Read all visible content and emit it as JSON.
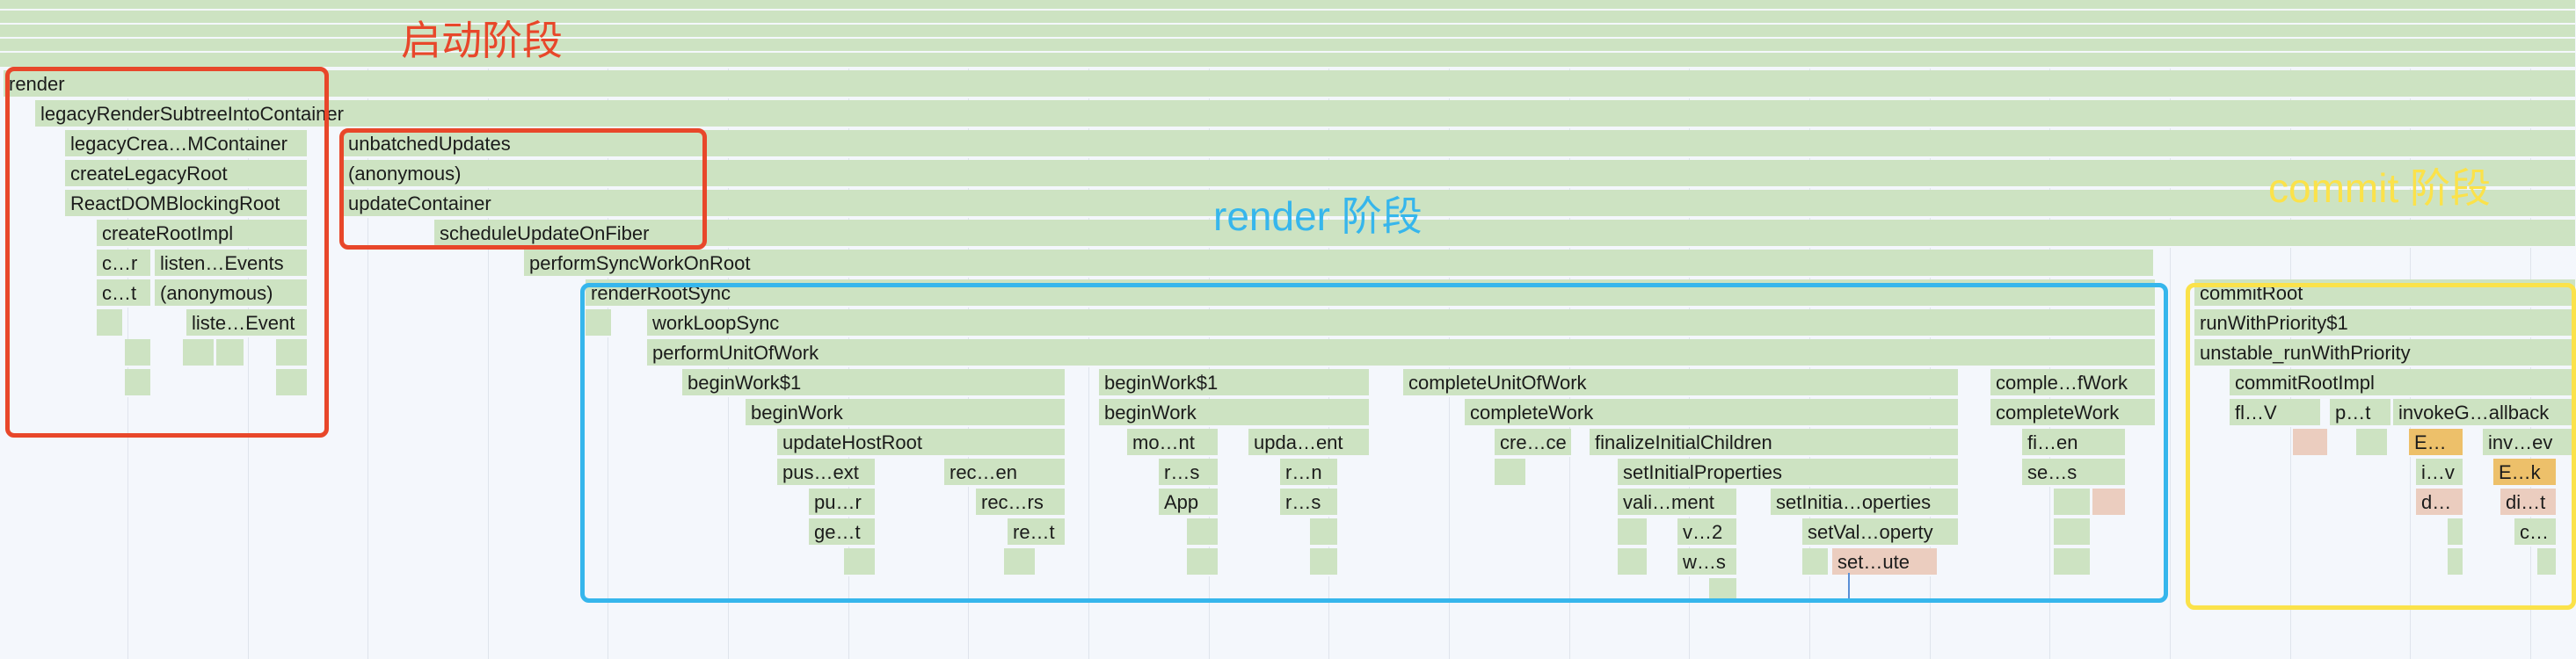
{
  "annotations": {
    "startup_label": "启动阶段",
    "render_label": "render 阶段",
    "commit_label": "commit 阶段"
  },
  "colors": {
    "frame": "#cde3c2",
    "frame_hot": "#edc06a",
    "frame_warm": "#ebcdbf",
    "startup": "#e8472a",
    "render": "#36b6ec",
    "commit": "#fbe24a"
  },
  "frames": {
    "render": "render",
    "legacyRenderSubtreeIntoContainer": "legacyRenderSubtreeIntoContainer",
    "legacyCreateMContainer": "legacyCrea…MContainer",
    "createLegacyRoot": "createLegacyRoot",
    "ReactDOMBlockingRoot": "ReactDOMBlockingRoot",
    "createRootImpl": "createRootImpl",
    "c_r": "c…r",
    "listenEvents": "listen…Events",
    "c_t": "c…t",
    "anonymous_small": "(anonymous)",
    "listeEvent": "liste…Event",
    "unbatchedUpdates": "unbatchedUpdates",
    "anonymous": "(anonymous)",
    "updateContainer": "updateContainer",
    "scheduleUpdateOnFiber": "scheduleUpdateOnFiber",
    "performSyncWorkOnRoot": "performSyncWorkOnRoot",
    "renderRootSync": "renderRootSync",
    "workLoopSync": "workLoopSync",
    "performUnitOfWork": "performUnitOfWork",
    "beginWork1_a": "beginWork$1",
    "beginWork_a": "beginWork",
    "updateHostRoot": "updateHostRoot",
    "pusext": "pus…ext",
    "recen": "rec…en",
    "pur": "pu…r",
    "recrs": "rec…rs",
    "get": "ge…t",
    "ret": "re…t",
    "beginWork1_b": "beginWork$1",
    "beginWork_b": "beginWork",
    "mont": "mo…nt",
    "updaent": "upda…ent",
    "rs": "r…s",
    "rn": "r…n",
    "App": "App",
    "rs2": "r…s",
    "completeUnitOfWork": "completeUnitOfWork",
    "completeWork_a": "completeWork",
    "crece": "cre…ce",
    "finalizeInitialChildren": "finalizeInitialChildren",
    "setInitialProperties": "setInitialProperties",
    "valiment": "vali…ment",
    "setInitiaoperties": "setInitia…operties",
    "v2": "v…2",
    "setValoperty": "setVal…operty",
    "ws": "w…s",
    "setute": "set…ute",
    "compleWork": "comple…fWork",
    "completeWork_b": "completeWork",
    "fien": "fi…en",
    "ses": "se…s",
    "commitRoot": "commitRoot",
    "runWithPriority1": "runWithPriority$1",
    "unstable_runWithPriority": "unstable_runWithPriority",
    "commitRootImpl": "commitRootImpl",
    "flV": "fl…V",
    "pt": "p…t",
    "invokeGallback": "invokeG…allback",
    "E1": "E…",
    "invev": "inv…ev",
    "iv": "i…v",
    "Ek": "E…k",
    "d": "d…",
    "dit": "di…t",
    "c": "c…"
  }
}
